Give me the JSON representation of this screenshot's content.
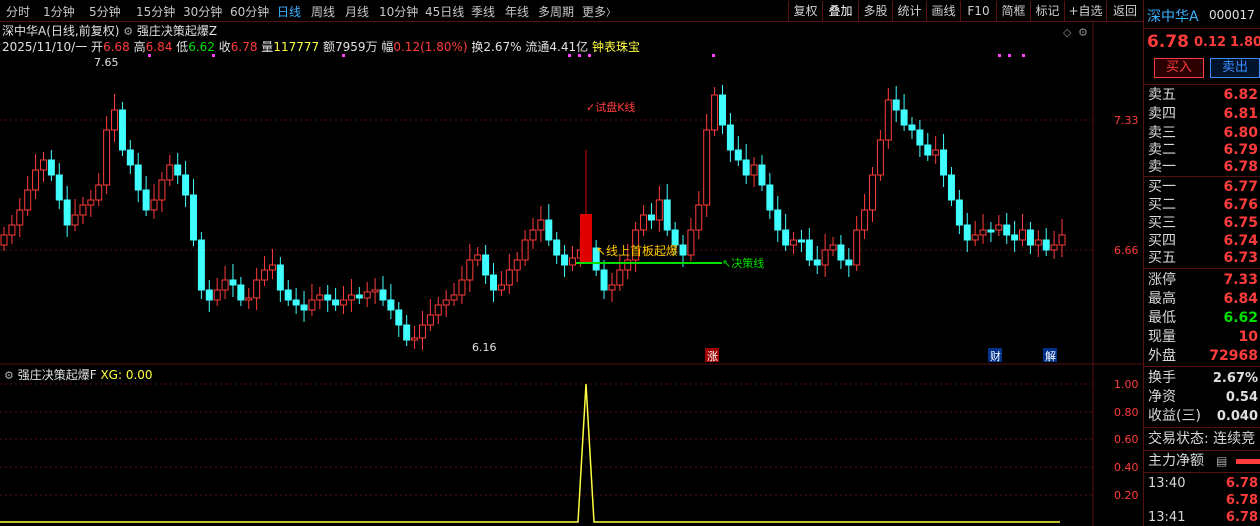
{
  "toolbar": {
    "tabs": [
      "分时",
      "1分钟",
      "5分钟",
      "15分钟",
      "30分钟",
      "60分钟",
      "日线",
      "周线",
      "月线",
      "10分钟",
      "45日线",
      "季线",
      "年线",
      "多周期",
      "更多"
    ],
    "active_tab": "日线",
    "more_arrow": "〉",
    "right_buttons": [
      "复权",
      "叠加",
      "多股",
      "统计",
      "画线",
      "F10",
      "简框",
      "标记",
      "+自选",
      "返回"
    ]
  },
  "chart_header": {
    "title": "深中华A(日线,前复权)",
    "indicator_name": "强庄决策起爆Z",
    "date": "2025/11/10/一",
    "open_label": "开",
    "open": "6.68",
    "high_label": "高",
    "high": "6.84",
    "low_label": "低",
    "low": "6.62",
    "close_label": "收",
    "close": "6.78",
    "vol_label": "量",
    "vol": "117777",
    "amount_label": "额",
    "amount": "7959万",
    "change_label": "幅",
    "change": "0.12(1.80%)",
    "turnover_label": "换",
    "turnover": "2.67%",
    "float_label": "流通",
    "float_cap": "4.41亿",
    "extra": "钟表珠宝"
  },
  "annotations": {
    "high_mark": "7.65",
    "low_mark": "6.16",
    "trial_kline": "✓试盘K线",
    "breakout": "↖线上首板起爆",
    "decision_line": "↖决策线",
    "flag_limit": "涨",
    "flag_fin": "财",
    "flag_unlock": "解"
  },
  "price_axis": [
    "7.33",
    "6.66"
  ],
  "indicator": {
    "name": "强庄决策起爆F",
    "xg_label": "XG: 0.00",
    "axis": [
      "1.00",
      "0.80",
      "0.60",
      "0.40",
      "0.20"
    ]
  },
  "side": {
    "stock_name": "深中华A",
    "code": "000017",
    "price": "6.78",
    "change": "0.12",
    "pct": "1.80",
    "buy_label": "买入",
    "sell_label": "卖出",
    "asks": [
      {
        "label": "卖五",
        "price": "6.82"
      },
      {
        "label": "卖四",
        "price": "6.81"
      },
      {
        "label": "卖三",
        "price": "6.80"
      },
      {
        "label": "卖二",
        "price": "6.79"
      },
      {
        "label": "卖一",
        "price": "6.78"
      }
    ],
    "bids": [
      {
        "label": "买一",
        "price": "6.77"
      },
      {
        "label": "买二",
        "price": "6.76"
      },
      {
        "label": "买三",
        "price": "6.75"
      },
      {
        "label": "买四",
        "price": "6.74"
      },
      {
        "label": "买五",
        "price": "6.73"
      }
    ],
    "stats": [
      {
        "label": "涨停",
        "value": "7.33",
        "color": "#ff3c3c"
      },
      {
        "label": "最高",
        "value": "6.84",
        "color": "#ff3c3c"
      },
      {
        "label": "最低",
        "value": "6.62",
        "color": "#00e000"
      },
      {
        "label": "现量",
        "value": "10",
        "color": "#ff3c3c"
      },
      {
        "label": "外盘",
        "value": "72968",
        "color": "#ff3c3c"
      }
    ],
    "stats2": [
      {
        "label": "换手",
        "value": "2.67%"
      },
      {
        "label": "净资",
        "value": "0.54"
      },
      {
        "label": "收益(三)",
        "value": "0.040"
      }
    ],
    "trade_status": "交易状态: 连续竞",
    "main_net": "主力净额",
    "ticks": [
      {
        "time": "13:40",
        "price": "6.78"
      },
      {
        "time": "",
        "price": "6.78"
      },
      {
        "time": "13:41",
        "price": "6.78"
      }
    ]
  },
  "colors": {
    "up": "#ff3c3c",
    "down": "#40ffff",
    "grid": "#5a1010",
    "accent": "#3ab0ff"
  }
}
